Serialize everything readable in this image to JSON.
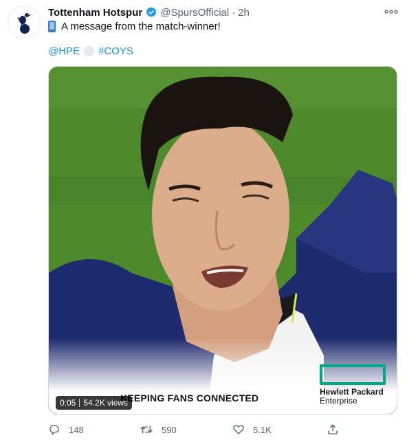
{
  "tweet": {
    "author_name": "Tottenham Hotspur",
    "handle": "@SpursOfficial",
    "separator": "·",
    "time": "2h",
    "emoji_icon": "mobile-phone-icon",
    "text": "A message from the match-winner!",
    "mention": "@HPE",
    "hashtag": "#COYS"
  },
  "video": {
    "caption": "KEEPING FANS CONNECTED",
    "sponsor_line1": "Hewlett Packard",
    "sponsor_line2": "Enterprise",
    "current_time": "0:05",
    "views": "54.2K views"
  },
  "actions": {
    "reply_count": "148",
    "retweet_count": "590",
    "like_count": "5.1K"
  },
  "colors": {
    "link": "#1b95e0",
    "verified": "#1d9bf0",
    "muted": "#536471",
    "hpe_green": "#01a982",
    "pitch_green": "#4d8a2c"
  }
}
